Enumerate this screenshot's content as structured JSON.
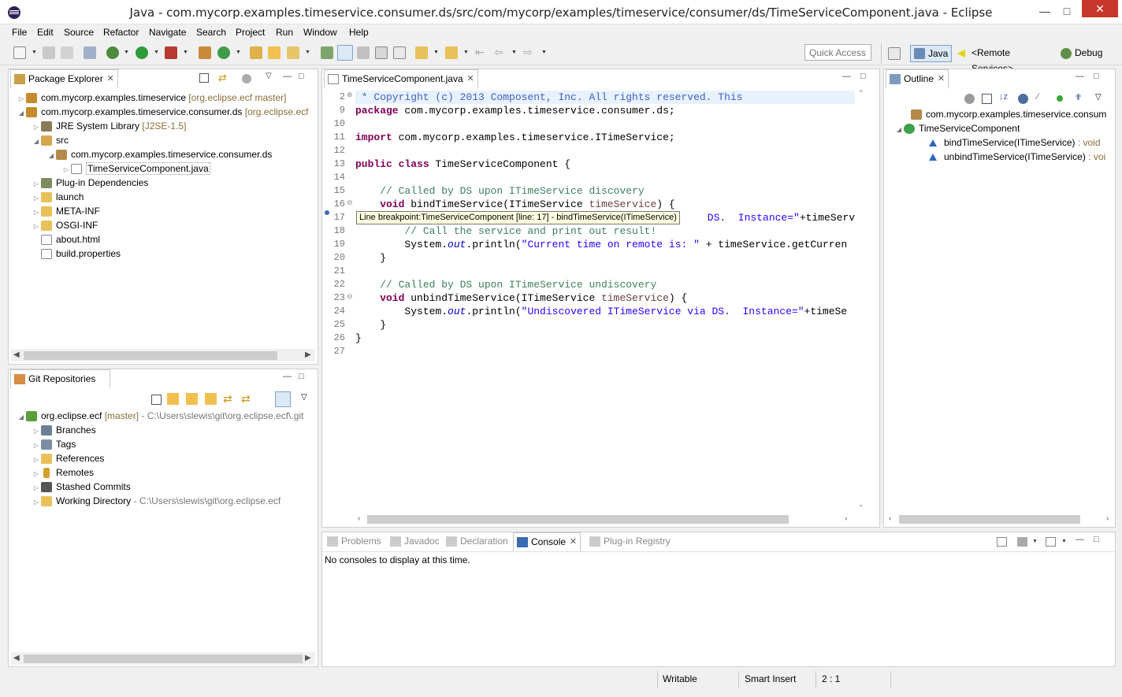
{
  "window": {
    "title": "Java - com.mycorp.examples.timeservice.consumer.ds/src/com/mycorp/examples/timeservice/consumer/ds/TimeServiceComponent.java - Eclipse"
  },
  "menu": [
    "File",
    "Edit",
    "Source",
    "Refactor",
    "Navigate",
    "Search",
    "Project",
    "Run",
    "Window",
    "Help"
  ],
  "toolbar": {
    "quick_access": "Quick Access"
  },
  "perspectives": [
    "Java",
    "<Remote Services>",
    "Debug"
  ],
  "package_explorer": {
    "tab": "Package Explorer",
    "rows": [
      {
        "label": "com.mycorp.examples.timeservice",
        "decor": "[org.eclipse.ecf master]"
      },
      {
        "label": "com.mycorp.examples.timeservice.consumer.ds",
        "decor": "[org.eclipse.ecf"
      },
      {
        "label": "JRE System Library",
        "decor": "[J2SE-1.5]"
      },
      {
        "label": "src",
        "decor": ""
      },
      {
        "label": "com.mycorp.examples.timeservice.consumer.ds",
        "decor": ""
      },
      {
        "label": "TimeServiceComponent.java",
        "decor": ""
      },
      {
        "label": "Plug-in Dependencies",
        "decor": ""
      },
      {
        "label": "launch",
        "decor": ""
      },
      {
        "label": "META-INF",
        "decor": ""
      },
      {
        "label": "OSGI-INF",
        "decor": ""
      },
      {
        "label": "about.html",
        "decor": ""
      },
      {
        "label": "build.properties",
        "decor": ""
      }
    ]
  },
  "git_repositories": {
    "tab": "Git Repositories",
    "repo": {
      "label": "org.eclipse.ecf",
      "branch": "[master]",
      "path": "- C:\\Users\\slewis\\git\\org.eclipse.ecf\\.git"
    },
    "rows": [
      {
        "label": "Branches",
        "decor": ""
      },
      {
        "label": "Tags",
        "decor": ""
      },
      {
        "label": "References",
        "decor": ""
      },
      {
        "label": "Remotes",
        "decor": ""
      },
      {
        "label": "Stashed Commits",
        "decor": ""
      },
      {
        "label": "Working Directory",
        "decor": "- C:\\Users\\slewis\\git\\org.eclipse.ecf"
      }
    ]
  },
  "editor": {
    "tab": "TimeServiceComponent.java",
    "line_numbers": [
      "2",
      "9",
      "10",
      "11",
      "12",
      "13",
      "14",
      "15",
      "16",
      "17",
      "18",
      "19",
      "20",
      "21",
      "22",
      "23",
      "24",
      "25",
      "26",
      "27"
    ],
    "tooltip": "Line breakpoint:TimeServiceComponent [line: 17] - bindTimeService(ITimeService)",
    "code": {
      "l2": " * Copyright (c) 2013 Composent, Inc. All rights reserved. This",
      "l9a": "package",
      "l9b": " com.mycorp.examples.timeservice.consumer.ds;",
      "l11a": "import",
      "l11b": " com.mycorp.examples.timeservice.ITimeService;",
      "l13a": "public class",
      "l13b": " TimeServiceComponent {",
      "l15": "    // Called by DS upon ITimeService discovery",
      "l16a": "    void",
      "l16b": " bindTimeService(ITimeService ",
      "l16c": "timeService",
      "l16d": ") {",
      "l17a": " DS.  Instance=\"",
      "l17b": "+timeServ",
      "l18": "        // Call the service and print out result!",
      "l19a": "        System.",
      "l19b": "out",
      "l19c": ".println(",
      "l19d": "\"Current time on remote is: \"",
      "l19e": " + timeService.getCurren",
      "l20": "    }",
      "l22": "    // Called by DS upon ITimeService undiscovery",
      "l23a": "    void",
      "l23b": " unbindTimeService(ITimeService ",
      "l23c": "timeService",
      "l23d": ") {",
      "l24a": "        System.",
      "l24b": "out",
      "l24c": ".println(",
      "l24d": "\"Undiscovered ITimeService via DS.  Instance=\"",
      "l24e": "+timeSe",
      "l25": "    }",
      "l26": "}"
    }
  },
  "outline": {
    "tab": "Outline",
    "rows": [
      {
        "label": "com.mycorp.examples.timeservice.consum",
        "decor": ""
      },
      {
        "label": "TimeServiceComponent",
        "decor": ""
      },
      {
        "label": "bindTimeService(ITimeService)",
        "decor": ": void"
      },
      {
        "label": "unbindTimeService(ITimeService)",
        "decor": ": voi"
      }
    ]
  },
  "bottom": {
    "tabs": [
      "Problems",
      "Javadoc",
      "Declaration",
      "Console",
      "Plug-in Registry"
    ],
    "active": "Console",
    "message": "No consoles to display at this time."
  },
  "status": {
    "writable": "Writable",
    "insert_mode": "Smart Insert",
    "position": "2 : 1"
  },
  "colors": {
    "keyword": "#7f0055",
    "comment": "#3f7f5f",
    "javadoc": "#3f5fbf",
    "string": "#2a00ff",
    "close": "#c7362a"
  }
}
